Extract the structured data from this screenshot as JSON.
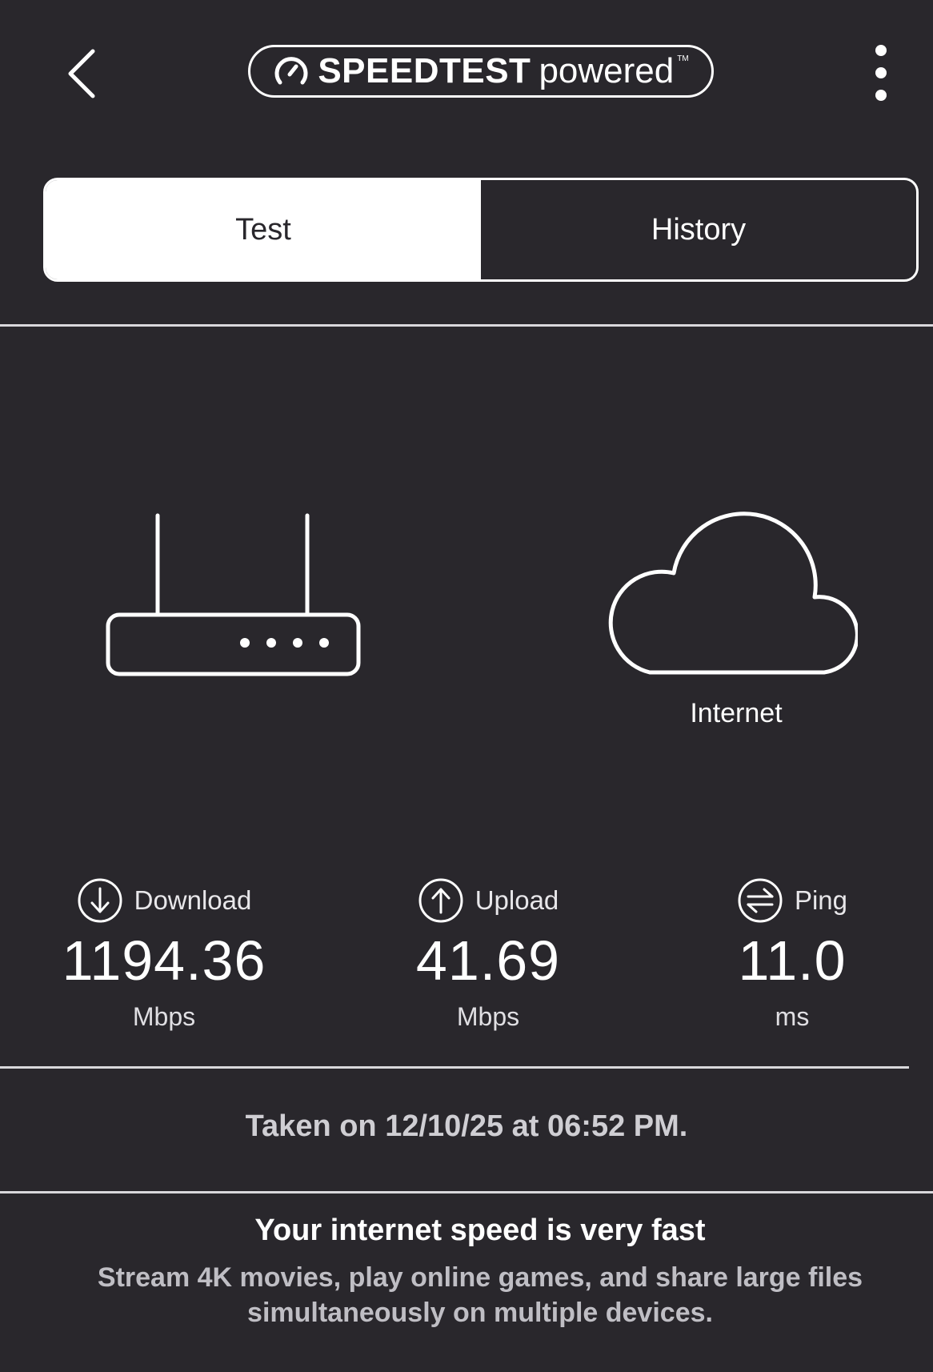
{
  "header": {
    "back_icon": "chevron-left-icon",
    "logo": {
      "icon": "speedometer-icon",
      "brand": "SPEEDTEST",
      "suffix": "powered",
      "tm": "TM"
    },
    "more_icon": "vertical-ellipsis-icon"
  },
  "tabs": [
    {
      "label": "Test",
      "active": true
    },
    {
      "label": "History",
      "active": false
    }
  ],
  "diagram": {
    "router_icon": "router-icon",
    "cloud_icon": "cloud-icon",
    "internet_label": "Internet"
  },
  "metrics": {
    "download": {
      "icon": "download-arrow-icon",
      "label": "Download",
      "value": "1194.36",
      "unit": "Mbps"
    },
    "upload": {
      "icon": "upload-arrow-icon",
      "label": "Upload",
      "value": "41.69",
      "unit": "Mbps"
    },
    "ping": {
      "icon": "ping-arrows-icon",
      "label": "Ping",
      "value": "11.0",
      "unit": "ms"
    }
  },
  "taken_on": "Taken on 12/10/25 at 06:52 PM.",
  "verdict": {
    "title": "Your internet speed is very fast",
    "description": "Stream 4K movies, play online games, and share large files simultaneously on multiple devices."
  },
  "colors": {
    "background": "#29272c",
    "foreground": "#ffffff",
    "muted_text": "#bfbec4"
  }
}
